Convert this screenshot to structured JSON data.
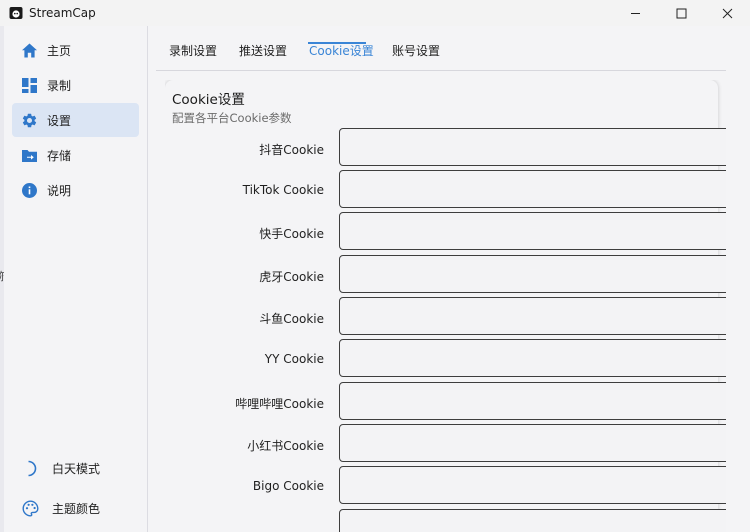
{
  "window": {
    "title": "StreamCap",
    "controls": [
      "minimize-icon",
      "maximize-icon",
      "close-icon"
    ]
  },
  "edge_glyph": "称",
  "sidebar": {
    "items": [
      {
        "label": "主页",
        "icon": "home-icon",
        "active": false
      },
      {
        "label": "录制",
        "icon": "dashboard-icon",
        "active": false
      },
      {
        "label": "设置",
        "icon": "gear-icon",
        "active": true
      },
      {
        "label": "存储",
        "icon": "folder-arrow-icon",
        "active": false
      },
      {
        "label": "说明",
        "icon": "info-icon",
        "active": false
      }
    ],
    "bottom": [
      {
        "label": "白天模式",
        "icon": "moon-icon"
      },
      {
        "label": "主题颜色",
        "icon": "palette-icon"
      }
    ]
  },
  "tabs": [
    {
      "label": "录制设置",
      "active": false
    },
    {
      "label": "推送设置",
      "active": false
    },
    {
      "label": "Cookie设置",
      "active": true
    },
    {
      "label": "账号设置",
      "active": false
    }
  ],
  "card": {
    "title": "Cookie设置",
    "subtitle": "配置各平台Cookie参数",
    "fields": [
      {
        "label": "抖音Cookie",
        "value": ""
      },
      {
        "label": "TikTok Cookie",
        "value": ""
      },
      {
        "label": "快手Cookie",
        "value": ""
      },
      {
        "label": "虎牙Cookie",
        "value": ""
      },
      {
        "label": "斗鱼Cookie",
        "value": ""
      },
      {
        "label": "YY Cookie",
        "value": ""
      },
      {
        "label": "哔哩哔哩Cookie",
        "value": ""
      },
      {
        "label": "小红书Cookie",
        "value": ""
      },
      {
        "label": "Bigo Cookie",
        "value": ""
      }
    ]
  },
  "colors": {
    "accent": "#3a85d6",
    "active_bg": "#dbe5f4"
  }
}
